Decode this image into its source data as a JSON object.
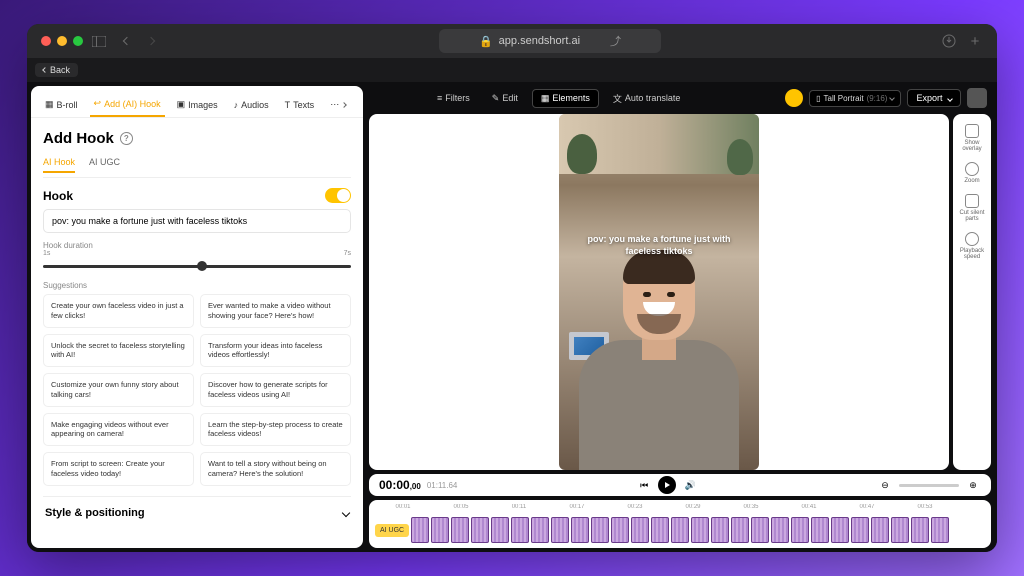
{
  "browser": {
    "url": "app.sendshort.ai"
  },
  "back_button": "Back",
  "topnav": {
    "filters": "Filters",
    "edit": "Edit",
    "elements": "Elements",
    "auto_translate": "Auto translate",
    "aspect": "Tall Portrait",
    "aspect_ratio": "(9:16)",
    "export": "Export"
  },
  "sidepanel": {
    "tabs": [
      "B-roll",
      "Add (AI) Hook",
      "Images",
      "Audios",
      "Texts"
    ],
    "active_tab": 1,
    "title": "Add Hook",
    "subtabs": [
      "AI Hook",
      "AI UGC"
    ],
    "active_subtab": 0,
    "hook": {
      "label": "Hook",
      "enabled": true,
      "value": "pov: you make a fortune just with faceless tiktoks"
    },
    "duration": {
      "label": "Hook duration",
      "min_label": "1s",
      "max_label": "7s"
    },
    "suggestions_label": "Suggestions",
    "suggestions": [
      "Create your own faceless video in just a few clicks!",
      "Ever wanted to make a video without showing your face? Here's how!",
      "Unlock the secret to faceless storytelling with AI!",
      "Transform your ideas into faceless videos effortlessly!",
      "Customize your own funny story about talking cars!",
      "Discover how to generate scripts for faceless videos using AI!",
      "Make engaging videos without ever appearing on camera!",
      "Learn the step-by-step process to create faceless videos!",
      "From script to screen: Create your faceless video today!",
      "Want to tell a story without being on camera? Here's the solution!"
    ],
    "style_section": "Style & positioning"
  },
  "right_tools": {
    "overlay": "Show overlay",
    "zoom": "Zoom",
    "cutsilent": "Cut silent parts",
    "speed": "Playback speed"
  },
  "player": {
    "overlay_text": "pov: you make a fortune just with faceless tiktoks",
    "current": "00:00",
    "current_frac": ",00",
    "duration": "01:11.64"
  },
  "timeline": {
    "track_label": "AI UGC",
    "ticks": [
      "00:01",
      "00:05",
      "00:11",
      "00:17",
      "00:23",
      "00:29",
      "00:35",
      "00:41",
      "00:47",
      "00:53"
    ]
  }
}
